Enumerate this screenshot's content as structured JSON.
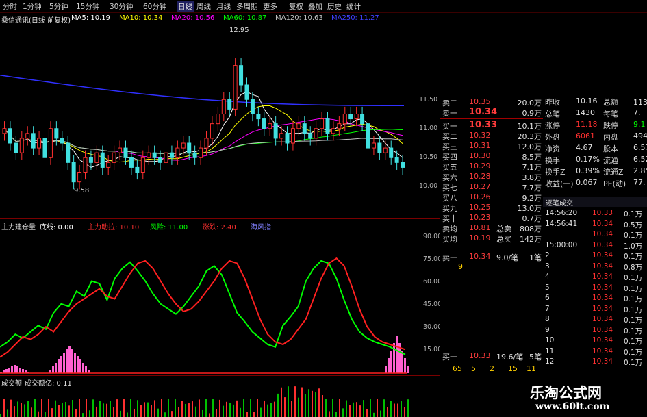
{
  "toolbar": {
    "periods": [
      "分时",
      "1分钟",
      "5分钟",
      "15分钟",
      "30分钟",
      "60分钟",
      "日线",
      "周线",
      "月线",
      "多周期",
      "更多"
    ],
    "active_period": "日线",
    "right_buttons": [
      "复权",
      "叠加",
      "历史",
      "统计"
    ]
  },
  "main_chart": {
    "title": "桑信通讯(日线 前复权)",
    "ma_labels": [
      {
        "text": "MA5: 10.19",
        "color": "#ffffff"
      },
      {
        "text": "MA10: 10.34",
        "color": "#ffff00"
      },
      {
        "text": "MA20: 10.56",
        "color": "#ff00ff"
      },
      {
        "text": "MA60: 10.87",
        "color": "#00ff00"
      },
      {
        "text": "MA120: 10.63",
        "color": "#c0c0c0"
      },
      {
        "text": "MA250: 11.27",
        "color": "#4040ff"
      }
    ],
    "high_label": "12.95",
    "low_label": "9.58",
    "price_scale": [
      "11.50",
      "11.00",
      "10.50",
      "10.00"
    ],
    "closes": [
      10.9,
      10.6,
      10.4,
      10.7,
      10.8,
      10.5,
      10.7,
      10.3,
      10.9,
      10.7,
      10.6,
      10.2,
      9.8,
      10.0,
      10.3,
      10.2,
      10.4,
      10.1,
      10.2,
      10.4,
      10.5,
      10.3,
      10.1,
      10.0,
      10.3,
      10.4,
      10.3,
      10.2,
      10.4,
      10.3,
      10.5,
      10.6,
      10.4,
      10.3,
      10.5,
      10.7,
      11.0,
      11.2,
      11.5,
      11.3,
      12.2,
      11.8,
      11.5,
      11.2,
      11.1,
      10.9,
      11.0,
      10.7,
      10.8,
      10.6,
      10.9,
      11.0,
      10.8,
      10.7,
      10.9,
      11.1,
      10.8,
      10.9,
      11.0,
      11.2,
      11.1,
      11.2,
      11.0,
      10.5,
      10.6,
      10.4,
      10.5,
      10.3,
      10.2,
      10.1
    ]
  },
  "indicator": {
    "title": "主力建仓量",
    "labels": [
      {
        "text": "底线: 0.00",
        "color": "#ffffff"
      },
      {
        "text": "主力助拉: 10.10",
        "color": "#ff3030"
      },
      {
        "text": "风险: 11.00",
        "color": "#00ff00"
      },
      {
        "text": "涨跌: 2.40",
        "color": "#ff3030"
      },
      {
        "text": "海风指",
        "color": "#8080ff"
      }
    ],
    "scale": [
      "90.00",
      "75.00",
      "60.00",
      "45.00",
      "30.00",
      "15.00"
    ],
    "green_line": [
      18,
      22,
      28,
      25,
      30,
      35,
      32,
      45,
      52,
      50,
      62,
      58,
      70,
      68,
      55,
      72,
      80,
      85,
      78,
      70,
      60,
      52,
      48,
      44,
      50,
      58,
      66,
      78,
      82,
      75,
      60,
      45,
      38,
      30,
      25,
      20,
      18,
      35,
      42,
      50,
      70,
      80,
      86,
      84,
      72,
      55,
      40,
      30,
      25,
      22,
      20,
      18,
      15,
      12
    ],
    "red_line": [
      10,
      14,
      20,
      26,
      24,
      28,
      34,
      30,
      38,
      46,
      52,
      56,
      60,
      64,
      58,
      56,
      66,
      76,
      84,
      86,
      80,
      70,
      60,
      52,
      46,
      48,
      54,
      62,
      70,
      80,
      86,
      84,
      72,
      56,
      40,
      28,
      22,
      20,
      24,
      32,
      40,
      56,
      72,
      84,
      88,
      82,
      66,
      48,
      34,
      26,
      22,
      20,
      18,
      16
    ]
  },
  "volume_panel": {
    "title": "成交额",
    "label": "成交额亿: 0.11"
  },
  "quote_panel": {
    "sells": [
      {
        "label": "卖二",
        "price": "10.35",
        "vol": "20.0万"
      },
      {
        "label": "卖一",
        "price": "10.34",
        "vol": "0.9万"
      }
    ],
    "buys": [
      {
        "label": "买一",
        "price": "10.33",
        "vol": "10.1万"
      },
      {
        "label": "买二",
        "price": "10.32",
        "vol": "20.3万"
      },
      {
        "label": "买三",
        "price": "10.31",
        "vol": "12.0万"
      },
      {
        "label": "买四",
        "price": "10.30",
        "vol": "8.5万"
      },
      {
        "label": "买五",
        "price": "10.29",
        "vol": "7.1万"
      },
      {
        "label": "买六",
        "price": "10.28",
        "vol": "3.8万"
      },
      {
        "label": "买七",
        "price": "10.27",
        "vol": "7.7万"
      },
      {
        "label": "买八",
        "price": "10.26",
        "vol": "9.2万"
      },
      {
        "label": "买九",
        "price": "10.25",
        "vol": "13.0万"
      },
      {
        "label": "买十",
        "price": "10.23",
        "vol": "0.7万"
      }
    ],
    "avg": [
      {
        "label": "卖均",
        "price": "10.81",
        "name": "总卖",
        "vol": "808万"
      },
      {
        "label": "买均",
        "price": "10.19",
        "name": "总买",
        "vol": "142万"
      }
    ],
    "sell1_detail": {
      "label": "卖一",
      "price": "10.34",
      "qty": "9.0/笔",
      "count": "1笔",
      "orders": "9"
    },
    "buy1_detail": {
      "label": "买一",
      "price": "10.33",
      "qty": "19.6/笔",
      "count": "5笔",
      "orders": [
        "65",
        "5",
        "2",
        "15",
        "11"
      ]
    }
  },
  "stats_panel": {
    "rows": [
      {
        "a": "昨收",
        "b": "10.16",
        "c": "总额",
        "d": "1137万"
      },
      {
        "a": "总笔",
        "b": "1430",
        "c": "每笔",
        "d": "7."
      },
      {
        "a": "涨停",
        "b": "11.18",
        "c": "跌停",
        "d": "9.1"
      },
      {
        "a": "外盘",
        "b": "6061",
        "c": "内盘",
        "d": "494"
      },
      {
        "a": "净资",
        "b": "4.67",
        "c": "股本",
        "d": "6.57"
      },
      {
        "a": "换手",
        "b": "0.17%",
        "c": "流通",
        "d": "6.52"
      },
      {
        "a": "换手Z",
        "b": "0.39%",
        "c": "流通Z",
        "d": "2.85"
      },
      {
        "a": "收益(一)",
        "b": "0.067",
        "c": "PE(动)",
        "d": "77."
      }
    ]
  },
  "ticks_panel": {
    "title": "逐笔成交",
    "rows": [
      {
        "t": "14:56:20",
        "p": "10.33",
        "v": "0.1万"
      },
      {
        "t": "14:56:41",
        "p": "10.34",
        "v": "0.5万"
      },
      {
        "t": "",
        "p": "10.34",
        "v": "0.1万"
      },
      {
        "t": "15:00:00",
        "p": "10.34",
        "v": "1.0万"
      },
      {
        "t": "2",
        "p": "10.34",
        "v": "0.1万"
      },
      {
        "t": "3",
        "p": "10.34",
        "v": "0.8万"
      },
      {
        "t": "4",
        "p": "10.34",
        "v": "0.1万"
      },
      {
        "t": "5",
        "p": "10.34",
        "v": "0.1万"
      },
      {
        "t": "6",
        "p": "10.34",
        "v": "0.1万"
      },
      {
        "t": "7",
        "p": "10.34",
        "v": "0.1万"
      },
      {
        "t": "8",
        "p": "10.34",
        "v": "0.1万"
      },
      {
        "t": "9",
        "p": "10.34",
        "v": "0.1万"
      },
      {
        "t": "10",
        "p": "10.34",
        "v": "0.1万"
      },
      {
        "t": "11",
        "p": "10.34",
        "v": "0.1万"
      },
      {
        "t": "12",
        "p": "10.34",
        "v": "0.1万"
      }
    ]
  },
  "watermark": {
    "title": "乐淘公式网",
    "url": "www.60lt.com"
  }
}
